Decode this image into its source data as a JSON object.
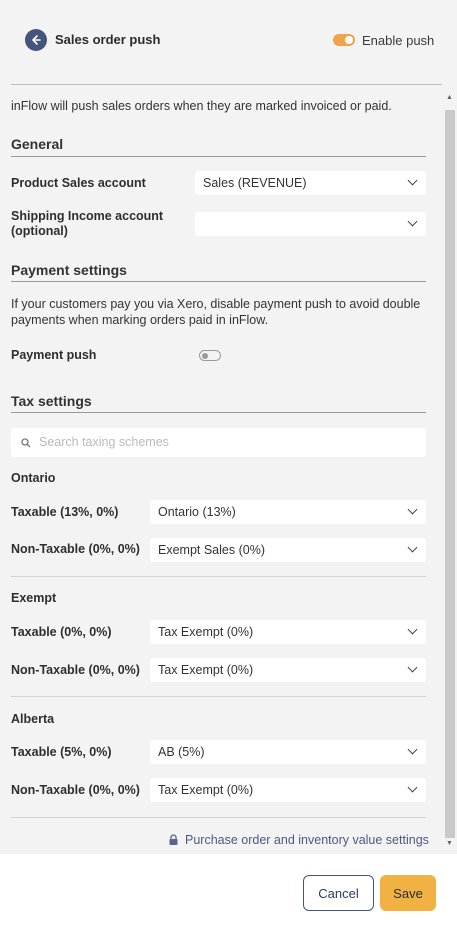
{
  "header": {
    "title": "Sales order push",
    "enable_label": "Enable push"
  },
  "intro": "inFlow will push sales orders when they are marked invoiced or paid.",
  "general": {
    "heading": "General",
    "product_sales_label": "Product Sales account",
    "product_sales_value": "Sales (REVENUE)",
    "shipping_label_1": "Shipping Income account",
    "shipping_label_2": "(optional)",
    "shipping_value": ""
  },
  "payment": {
    "heading": "Payment settings",
    "desc_1": "If your customers pay you via Xero, disable payment push to avoid double",
    "desc_2": "payments when marking orders paid in inFlow.",
    "push_label": "Payment push"
  },
  "tax": {
    "heading": "Tax settings",
    "search_placeholder": "Search taxing schemes",
    "groups": [
      {
        "name": "Ontario",
        "rows": [
          {
            "label": "Taxable (13%, 0%)",
            "value": "Ontario (13%)"
          },
          {
            "label": "Non-Taxable (0%, 0%)",
            "value": "Exempt Sales (0%)"
          }
        ]
      },
      {
        "name": "Exempt",
        "rows": [
          {
            "label": "Taxable (0%, 0%)",
            "value": "Tax Exempt (0%)"
          },
          {
            "label": "Non-Taxable (0%, 0%)",
            "value": "Tax Exempt (0%)"
          }
        ]
      },
      {
        "name": "Alberta",
        "rows": [
          {
            "label": "Taxable (5%, 0%)",
            "value": "AB (5%)"
          },
          {
            "label": "Non-Taxable (0%, 0%)",
            "value": "Tax Exempt (0%)"
          }
        ]
      }
    ]
  },
  "link": "Purchase order and inventory value settings",
  "footer": {
    "cancel": "Cancel",
    "save": "Save"
  },
  "colors": {
    "accent": "#eda44a",
    "save": "#f1b243",
    "navy": "#45547a"
  },
  "icons": {
    "back": "back-arrow-icon",
    "search": "search-icon",
    "lock": "lock-icon",
    "chevron": "chevron-down-icon"
  },
  "state": {
    "enable_push": true,
    "payment_push": false
  }
}
